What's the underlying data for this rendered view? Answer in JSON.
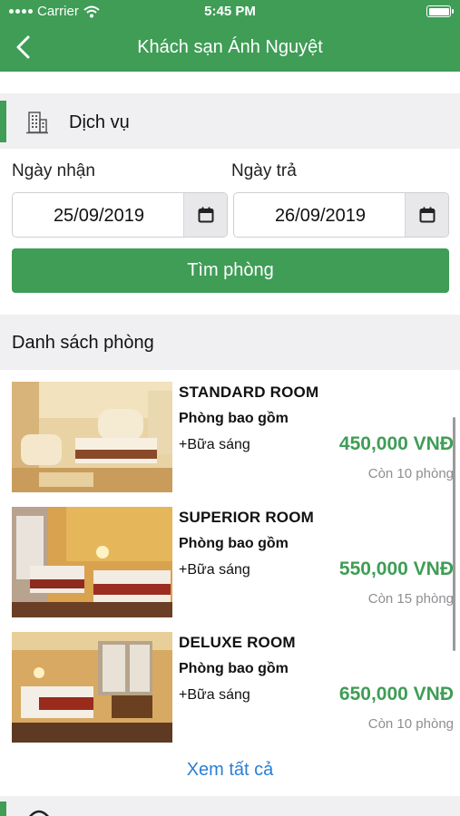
{
  "status_bar": {
    "carrier": "Carrier",
    "time": "5:45 PM"
  },
  "nav": {
    "title": "Khách sạn Ánh Nguyệt"
  },
  "service_section": {
    "label": "Dịch vụ"
  },
  "checkin": {
    "label": "Ngày nhận",
    "value": "25/09/2019"
  },
  "checkout": {
    "label": "Ngày trả",
    "value": "26/09/2019"
  },
  "search_button": {
    "label": "Tìm phòng"
  },
  "rooms_section": {
    "label": "Danh sách phòng"
  },
  "rooms": [
    {
      "name": "STANDARD ROOM",
      "includes": "Phòng bao gồm",
      "extra": "+Bữa sáng",
      "price": "450,000 VNĐ",
      "remaining": "Còn 10 phòng"
    },
    {
      "name": "SUPERIOR ROOM",
      "includes": "Phòng bao gồm",
      "extra": "+Bữa sáng",
      "price": "550,000 VNĐ",
      "remaining": "Còn 15 phòng"
    },
    {
      "name": "DELUXE ROOM",
      "includes": "Phòng bao gồm",
      "extra": "+Bữa sáng",
      "price": "650,000 VNĐ",
      "remaining": "Còn 10 phòng"
    }
  ],
  "see_all": {
    "label": "Xem tất cả"
  },
  "colors": {
    "brand_green": "#3f9d56",
    "link_blue": "#2a7fd4",
    "muted_gray": "#8e8e93"
  },
  "icons": [
    "wifi-icon",
    "battery-icon",
    "back-arrow-icon",
    "building-icon",
    "calendar-icon"
  ]
}
